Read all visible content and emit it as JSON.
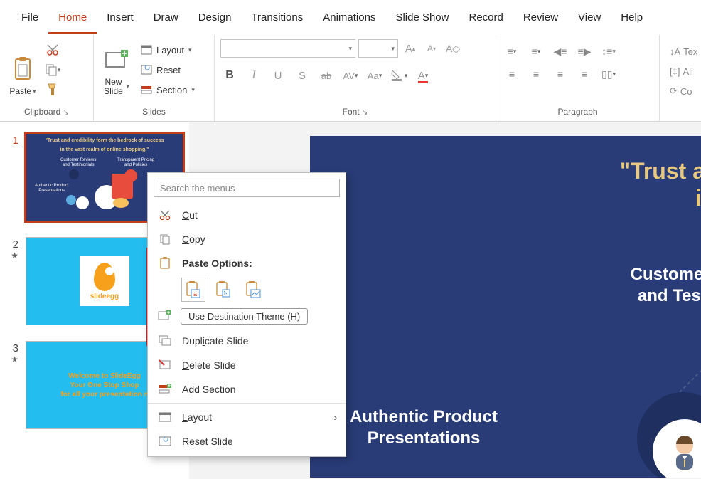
{
  "menu": {
    "file": "File",
    "home": "Home",
    "insert": "Insert",
    "draw": "Draw",
    "design": "Design",
    "transitions": "Transitions",
    "animations": "Animations",
    "slideshow": "Slide Show",
    "record": "Record",
    "review": "Review",
    "view": "View",
    "help": "Help"
  },
  "ribbon": {
    "clipboard": {
      "label": "Clipboard",
      "paste": "Paste"
    },
    "slides": {
      "label": "Slides",
      "newslide": "New\nSlide",
      "layout": "Layout",
      "reset": "Reset",
      "section": "Section"
    },
    "font": {
      "label": "Font",
      "bold": "B",
      "italic": "I",
      "underline": "U",
      "shadow": "S",
      "strike": "ab",
      "spacing": "AV",
      "case": "Aa"
    },
    "paragraph": {
      "label": "Paragraph"
    },
    "extra": {
      "text": "Tex",
      "align": "Ali",
      "convert": "Co"
    }
  },
  "thumbs": {
    "n1": "1",
    "n2": "2",
    "n3": "3",
    "t1_title1": "\"Trust and credibility form the bedrock of success",
    "t1_title2": "in the vast realm of online shopping.\"",
    "t1_c1": "Customer Reviews\nand Testimonials",
    "t1_c2": "Transparent Pricing\nand Policies",
    "t1_c3": "Authentic Product\nPresentations",
    "t2_logo": "slideegg",
    "t3_l1": "Welcome to SlideEgg",
    "t3_l2": "Your One Stop Shop",
    "t3_l3": "for all your presentation n"
  },
  "slide": {
    "title1": "\"Trust and credib",
    "title2": "in the vast",
    "sub1a": "Customer Reviews",
    "sub1b": "and Testimonials",
    "sub2a": "Authentic Product",
    "sub2b": "Presentations"
  },
  "context": {
    "search_placeholder": "Search the menus",
    "cut": "Cut",
    "copy": "Copy",
    "paste_options": "Paste Options:",
    "tooltip": "Use Destination Theme (H)",
    "duplicate": "Duplicate Slide",
    "delete": "Delete Slide",
    "add_section": "Add Section",
    "layout": "Layout",
    "reset": "Reset Slide"
  }
}
